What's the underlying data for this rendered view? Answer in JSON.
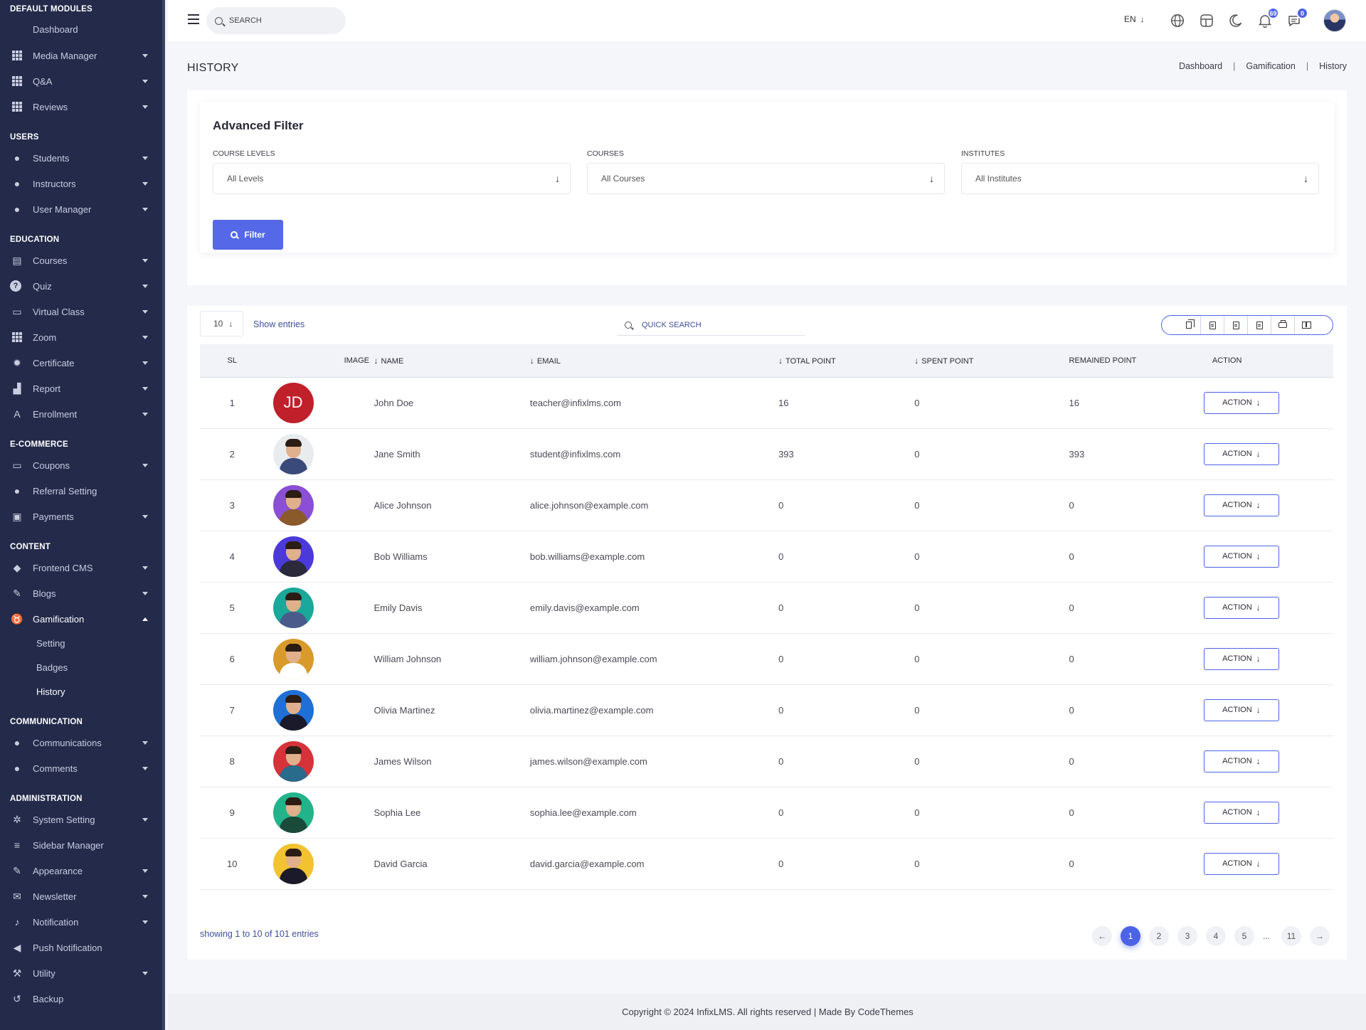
{
  "sidebar": {
    "sections": [
      {
        "title": "DEFAULT MODULES",
        "items": [
          {
            "label": "Dashboard",
            "icon": "none"
          },
          {
            "label": "Media Manager",
            "icon": "grid-icon"
          },
          {
            "label": "Q&A",
            "icon": "grid-icon"
          },
          {
            "label": "Reviews",
            "icon": "grid-icon"
          }
        ]
      },
      {
        "title": "USERS",
        "items": [
          {
            "label": "Students",
            "icon": "user-icon"
          },
          {
            "label": "Instructors",
            "icon": "user-tie-icon"
          },
          {
            "label": "User Manager",
            "icon": "user-gear-icon"
          }
        ]
      },
      {
        "title": "EDUCATION",
        "items": [
          {
            "label": "Courses",
            "icon": "book-icon"
          },
          {
            "label": "Quiz",
            "icon": "question-circle-icon"
          },
          {
            "label": "Virtual Class",
            "icon": "vr-goggles-icon"
          },
          {
            "label": "Zoom",
            "icon": "grid-icon"
          },
          {
            "label": "Certificate",
            "icon": "certificate-icon"
          },
          {
            "label": "Report",
            "icon": "chart-area-icon"
          },
          {
            "label": "Enrollment",
            "icon": "font-box-icon"
          }
        ]
      },
      {
        "title": "E-COMMERCE",
        "items": [
          {
            "label": "Coupons",
            "icon": "ticket-icon"
          },
          {
            "label": "Referral Setting",
            "icon": "users-icon"
          },
          {
            "label": "Payments",
            "icon": "money-icon"
          }
        ]
      },
      {
        "title": "CONTENT",
        "items": [
          {
            "label": "Frontend CMS",
            "icon": "layers-icon"
          },
          {
            "label": "Blogs",
            "icon": "edit-icon"
          },
          {
            "label": "Gamification",
            "icon": "medal-icon"
          }
        ]
      },
      {
        "title": "COMMUNICATION",
        "items": [
          {
            "label": "Communications",
            "icon": "comments-icon"
          },
          {
            "label": "Comments",
            "icon": "comment-icon"
          }
        ]
      },
      {
        "title": "ADMINISTRATION",
        "items": [
          {
            "label": "System Setting",
            "icon": "cogs-icon"
          },
          {
            "label": "Sidebar Manager",
            "icon": "bars-icon"
          },
          {
            "label": "Appearance",
            "icon": "brush-icon"
          },
          {
            "label": "Newsletter",
            "icon": "mail-bulk-icon"
          },
          {
            "label": "Notification",
            "icon": "bell-icon"
          },
          {
            "label": "Push Notification",
            "icon": "bullhorn-icon"
          },
          {
            "label": "Utility",
            "icon": "hammer-icon"
          },
          {
            "label": "Backup",
            "icon": "undo-icon"
          }
        ]
      }
    ],
    "gamification_sub": [
      "Setting",
      "Badges",
      "History"
    ]
  },
  "topbar": {
    "search_placeholder": "SEARCH",
    "language": "EN",
    "notifications_count": "69",
    "messages_count": "0"
  },
  "page": {
    "title": "HISTORY",
    "breadcrumb": [
      "Dashboard",
      "Gamification",
      "History"
    ]
  },
  "filter": {
    "title": "Advanced Filter",
    "course_levels_label": "COURSE LEVELS",
    "course_levels_value": "All Levels",
    "courses_label": "COURSES",
    "courses_value": "All Courses",
    "institutes_label": "INSTITUTES",
    "institutes_value": "All Institutes",
    "button_label": "Filter"
  },
  "table": {
    "page_size": "10",
    "show_entries_label": "Show entries",
    "quick_search_placeholder": "QUICK SEARCH",
    "columns": {
      "sl": "SL",
      "image": "IMAGE",
      "name": "NAME",
      "email": "EMAIL",
      "total": "TOTAL POINT",
      "spent": "SPENT POINT",
      "remained": "REMAINED POINT",
      "action": "ACTION"
    },
    "action_label": "ACTION",
    "rows": [
      {
        "sl": "1",
        "initials": "JD",
        "name": "John Doe",
        "email": "teacher@infixlms.com",
        "total": "16",
        "spent": "0",
        "remained": "16",
        "avatar_bg": "#c0202a"
      },
      {
        "sl": "2",
        "initials": "",
        "name": "Jane Smith",
        "email": "student@infixlms.com",
        "total": "393",
        "spent": "0",
        "remained": "393",
        "avatar_bg": "#e9ecef"
      },
      {
        "sl": "3",
        "initials": "",
        "name": "Alice Johnson",
        "email": "alice.johnson@example.com",
        "total": "0",
        "spent": "0",
        "remained": "0",
        "avatar_bg": "#8b4fd6"
      },
      {
        "sl": "4",
        "initials": "",
        "name": "Bob Williams",
        "email": "bob.williams@example.com",
        "total": "0",
        "spent": "0",
        "remained": "0",
        "avatar_bg": "#4b3ad9"
      },
      {
        "sl": "5",
        "initials": "",
        "name": "Emily Davis",
        "email": "emily.davis@example.com",
        "total": "0",
        "spent": "0",
        "remained": "0",
        "avatar_bg": "#1aa89a"
      },
      {
        "sl": "6",
        "initials": "",
        "name": "William Johnson",
        "email": "william.johnson@example.com",
        "total": "0",
        "spent": "0",
        "remained": "0",
        "avatar_bg": "#d89a2a"
      },
      {
        "sl": "7",
        "initials": "",
        "name": "Olivia Martinez",
        "email": "olivia.martinez@example.com",
        "total": "0",
        "spent": "0",
        "remained": "0",
        "avatar_bg": "#1f6fd6"
      },
      {
        "sl": "8",
        "initials": "",
        "name": "James Wilson",
        "email": "james.wilson@example.com",
        "total": "0",
        "spent": "0",
        "remained": "0",
        "avatar_bg": "#d6323a"
      },
      {
        "sl": "9",
        "initials": "",
        "name": "Sophia Lee",
        "email": "sophia.lee@example.com",
        "total": "0",
        "spent": "0",
        "remained": "0",
        "avatar_bg": "#22b38a"
      },
      {
        "sl": "10",
        "initials": "",
        "name": "David Garcia",
        "email": "david.garcia@example.com",
        "total": "0",
        "spent": "0",
        "remained": "0",
        "avatar_bg": "#f2c230"
      }
    ],
    "showing_text": "showing 1 to 10 of 101 entries",
    "pages": [
      "1",
      "2",
      "3",
      "4",
      "5",
      "...",
      "11"
    ],
    "current_page": "1"
  },
  "footer": {
    "text": "Copyright © 2024 InfixLMS. All rights reserved | Made By CodeThemes"
  },
  "colors": {
    "sidebar_bg": "#232a4a",
    "accent": "#4c63e6",
    "filter_button": "#5468e8"
  }
}
